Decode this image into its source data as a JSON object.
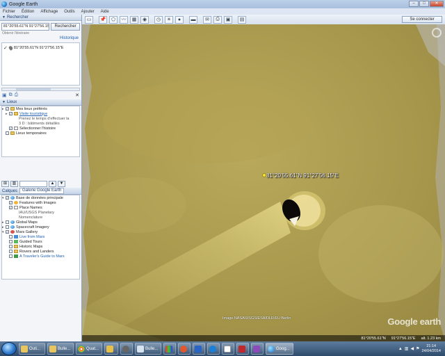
{
  "window": {
    "title": "Google Earth"
  },
  "menu": [
    "Fichier",
    "Édition",
    "Affichage",
    "Outils",
    "Ajouter",
    "Aide"
  ],
  "toolbar": {
    "connect_label": "Se connecter"
  },
  "search": {
    "header": "Rechercher",
    "query": "81°20'55.61\"N 91°27'56.15\"E",
    "button": "Rechercher",
    "hint": "Obtenir l'itinéraire",
    "history": "Historique",
    "result": "81°20'55.61\"N 91°27'56.15\"E"
  },
  "places": {
    "header": "Lieux",
    "items": [
      {
        "label": "Mes lieux préférés",
        "sub": false
      },
      {
        "label": "Visite touristique",
        "sub": false
      },
      {
        "label": "Prenez le temps d'effectuer la",
        "sub": true
      },
      {
        "label": "3 D : bâtiments détaillés",
        "sub": true
      },
      {
        "label": "Sélectionner l'histoire",
        "sub": false
      },
      {
        "label": "Lieux temporaires",
        "sub": false
      }
    ]
  },
  "layers": {
    "header": "Calques",
    "tab_gallery": "Galerie Google Earth",
    "items": [
      {
        "label": "Base de données principale",
        "sub": false
      },
      {
        "label": "Features with Images",
        "sub": true
      },
      {
        "label": "Place Names",
        "sub": true
      },
      {
        "label": "IAU/USGS Planetary",
        "sub": true
      },
      {
        "label": "Nomenclature",
        "sub": true
      },
      {
        "label": "Global Maps",
        "sub": false
      },
      {
        "label": "Spacecraft Imagery",
        "sub": false
      },
      {
        "label": "Mars Gallery",
        "sub": false
      },
      {
        "label": "Live from Mars",
        "sub": true
      },
      {
        "label": "Guided Tours",
        "sub": true
      },
      {
        "label": "Historic Maps",
        "sub": true
      },
      {
        "label": "Rovers and Landers",
        "sub": true
      },
      {
        "label": "A Traveler's Guide to Mars",
        "sub": true
      }
    ]
  },
  "map": {
    "placemark_label": "81°20'55.61\"N 91°27'56.15\"E",
    "attribution": "Image NASA/USGS/ESA/DLR/FU Berlin",
    "logo": "Google earth",
    "status": [
      "81°20'55.61\"N",
      "91°27'56.15\"E",
      "alt. 1.23 km"
    ]
  },
  "taskbar": {
    "items": [
      {
        "label": "Outi...",
        "color": "#e9c560"
      },
      {
        "label": "Bulle...",
        "color": "#e9c560"
      },
      {
        "label": "Quat...",
        "color": "#e7c04a"
      },
      {
        "label": "Bulle...",
        "color": "#d8e3f0"
      },
      {
        "label": "Goog...",
        "color": "#3b87d6"
      }
    ],
    "time": "21:14",
    "date": "24/04/2014"
  }
}
